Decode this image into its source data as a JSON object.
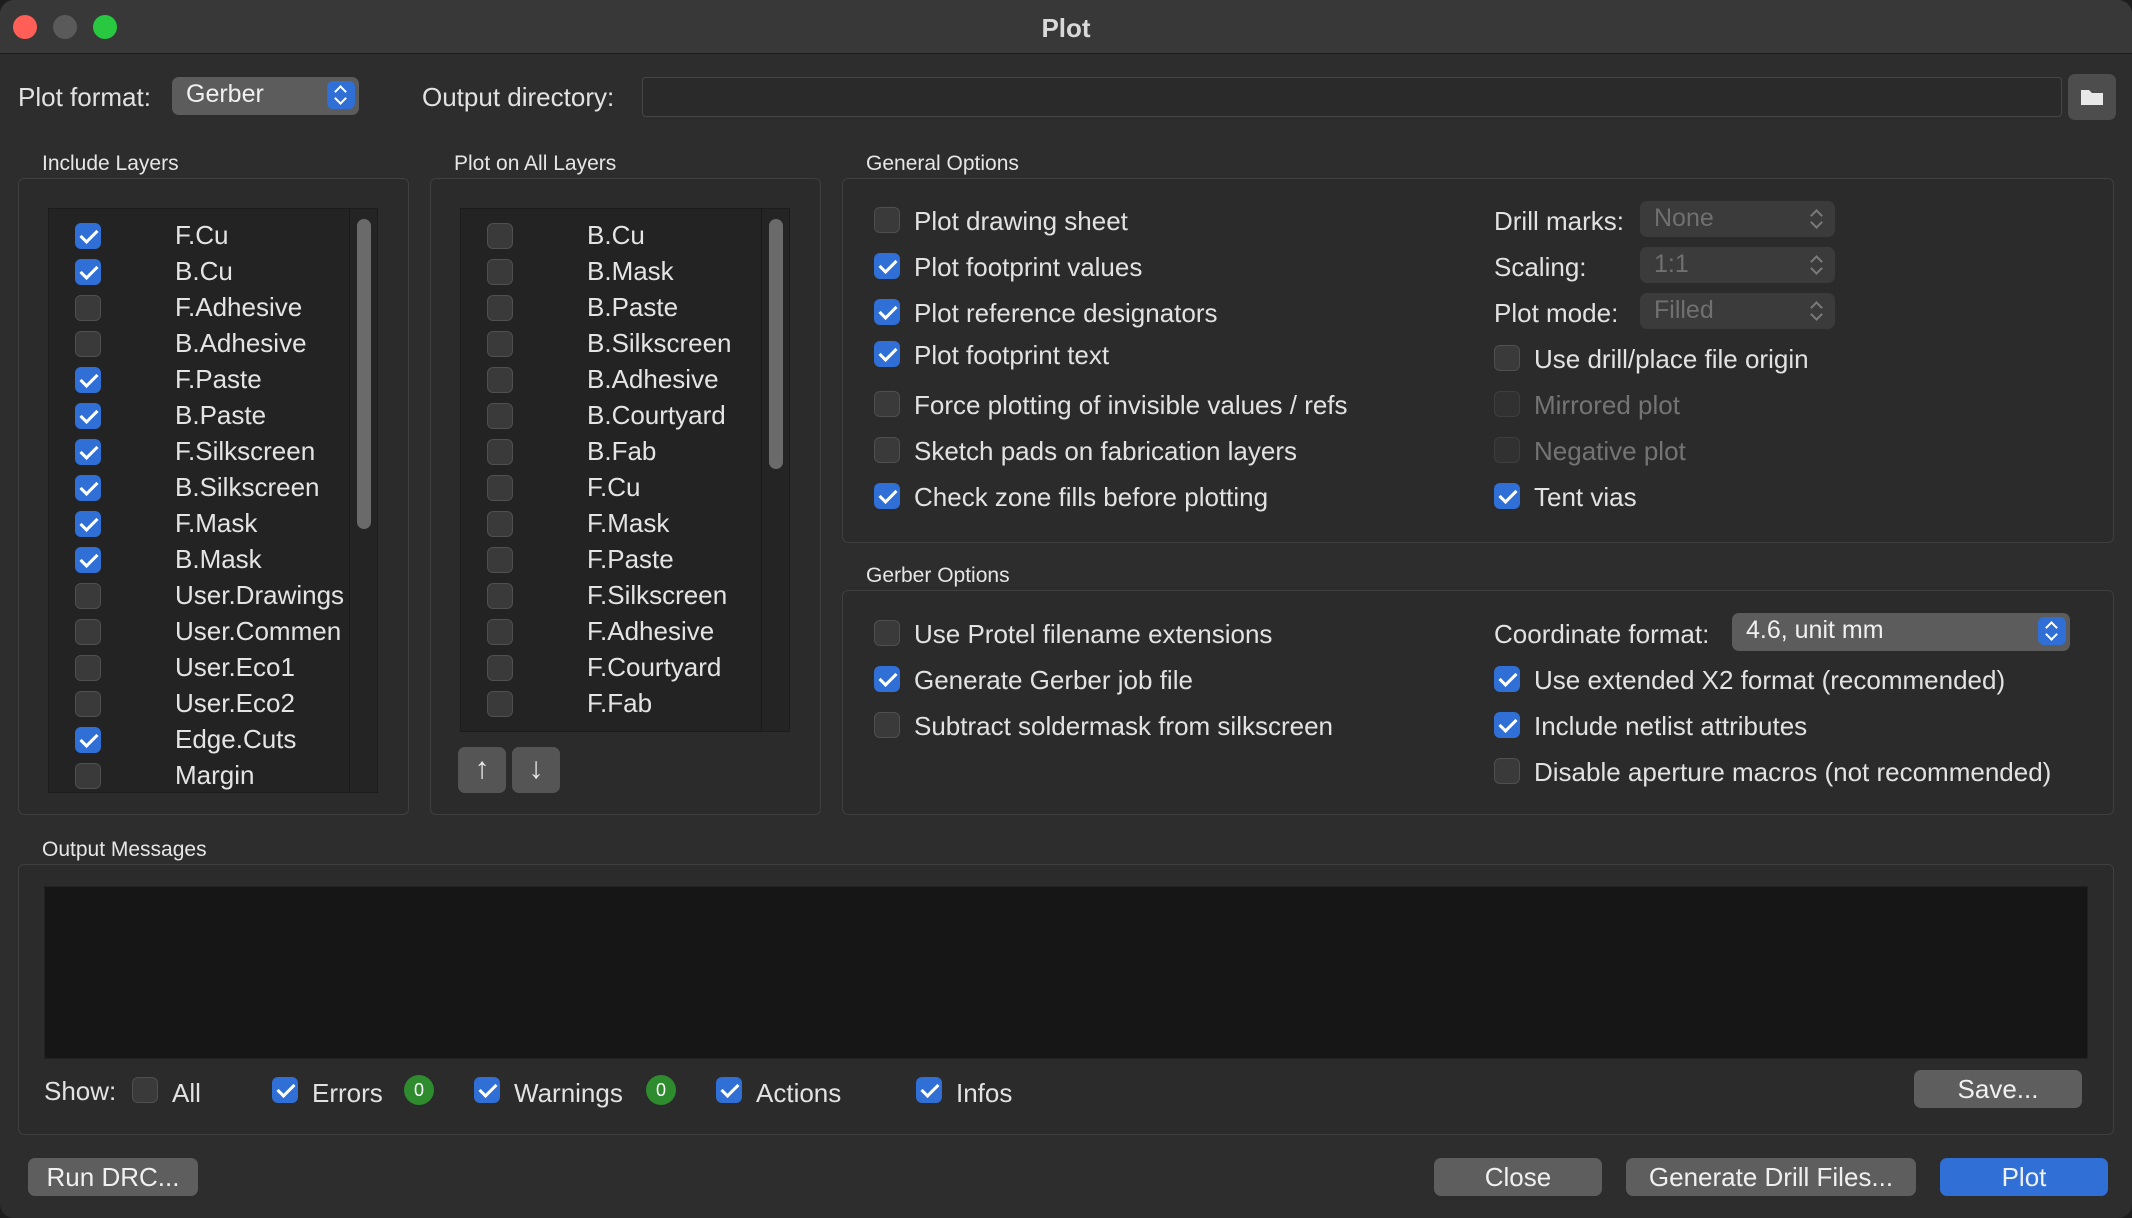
{
  "window": {
    "title": "Plot"
  },
  "top": {
    "plot_format_label": "Plot format:",
    "plot_format_value": "Gerber",
    "output_dir_label": "Output directory:",
    "output_dir_value": ""
  },
  "include_layers": {
    "title": "Include Layers",
    "items": [
      {
        "label": "F.Cu",
        "checked": true
      },
      {
        "label": "B.Cu",
        "checked": true
      },
      {
        "label": "F.Adhesive",
        "checked": false
      },
      {
        "label": "B.Adhesive",
        "checked": false
      },
      {
        "label": "F.Paste",
        "checked": true
      },
      {
        "label": "B.Paste",
        "checked": true
      },
      {
        "label": "F.Silkscreen",
        "checked": true
      },
      {
        "label": "B.Silkscreen",
        "checked": true
      },
      {
        "label": "F.Mask",
        "checked": true
      },
      {
        "label": "B.Mask",
        "checked": true
      },
      {
        "label": "User.Drawings",
        "checked": false
      },
      {
        "label": "User.Commen",
        "checked": false
      },
      {
        "label": "User.Eco1",
        "checked": false
      },
      {
        "label": "User.Eco2",
        "checked": false
      },
      {
        "label": "Edge.Cuts",
        "checked": true
      },
      {
        "label": "Margin",
        "checked": false
      }
    ]
  },
  "plot_all_layers": {
    "title": "Plot on All Layers",
    "items": [
      {
        "label": "B.Cu",
        "checked": false
      },
      {
        "label": "B.Mask",
        "checked": false
      },
      {
        "label": "B.Paste",
        "checked": false
      },
      {
        "label": "B.Silkscreen",
        "checked": false
      },
      {
        "label": "B.Adhesive",
        "checked": false
      },
      {
        "label": "B.Courtyard",
        "checked": false
      },
      {
        "label": "B.Fab",
        "checked": false
      },
      {
        "label": "F.Cu",
        "checked": false
      },
      {
        "label": "F.Mask",
        "checked": false
      },
      {
        "label": "F.Paste",
        "checked": false
      },
      {
        "label": "F.Silkscreen",
        "checked": false
      },
      {
        "label": "F.Adhesive",
        "checked": false
      },
      {
        "label": "F.Courtyard",
        "checked": false
      },
      {
        "label": "F.Fab",
        "checked": false
      }
    ],
    "up_arrow": "↑",
    "down_arrow": "↓"
  },
  "general": {
    "title": "General Options",
    "left": [
      {
        "label": "Plot drawing sheet",
        "checked": false
      },
      {
        "label": "Plot footprint values",
        "checked": true
      },
      {
        "label": "Plot reference designators",
        "checked": true
      },
      {
        "label": "Plot footprint text",
        "checked": true
      },
      {
        "label": "Force plotting of invisible values / refs",
        "checked": false
      },
      {
        "label": "Sketch pads on fabrication layers",
        "checked": false
      },
      {
        "label": "Check zone fills before plotting",
        "checked": true
      }
    ],
    "drill_marks_label": "Drill marks:",
    "drill_marks_value": "None",
    "scaling_label": "Scaling:",
    "scaling_value": "1:1",
    "plot_mode_label": "Plot mode:",
    "plot_mode_value": "Filled",
    "right": [
      {
        "label": "Use drill/place file origin",
        "checked": false,
        "disabled": false
      },
      {
        "label": "Mirrored plot",
        "checked": false,
        "disabled": true
      },
      {
        "label": "Negative plot",
        "checked": false,
        "disabled": true
      },
      {
        "label": "Tent vias",
        "checked": true,
        "disabled": false
      }
    ]
  },
  "gerber": {
    "title": "Gerber Options",
    "left": [
      {
        "label": "Use Protel filename extensions",
        "checked": false
      },
      {
        "label": "Generate Gerber job file",
        "checked": true
      },
      {
        "label": "Subtract soldermask from silkscreen",
        "checked": false
      }
    ],
    "coord_label": "Coordinate format:",
    "coord_value": "4.6, unit mm",
    "right": [
      {
        "label": "Use extended X2 format (recommended)",
        "checked": true
      },
      {
        "label": "Include netlist attributes",
        "checked": true
      },
      {
        "label": "Disable aperture macros (not recommended)",
        "checked": false
      }
    ]
  },
  "messages": {
    "title": "Output Messages",
    "show_label": "Show:",
    "filters": {
      "all": {
        "label": "All",
        "checked": false
      },
      "errors": {
        "label": "Errors",
        "checked": true,
        "count": "0"
      },
      "warnings": {
        "label": "Warnings",
        "checked": true,
        "count": "0"
      },
      "actions": {
        "label": "Actions",
        "checked": true
      },
      "infos": {
        "label": "Infos",
        "checked": true
      }
    },
    "save_label": "Save..."
  },
  "footer": {
    "run_drc": "Run DRC...",
    "close": "Close",
    "generate_drill": "Generate Drill Files...",
    "plot": "Plot"
  },
  "colors": {
    "accent": "#2f6fd6",
    "badge": "#2e8b2e",
    "bg": "#2d2d2d"
  }
}
